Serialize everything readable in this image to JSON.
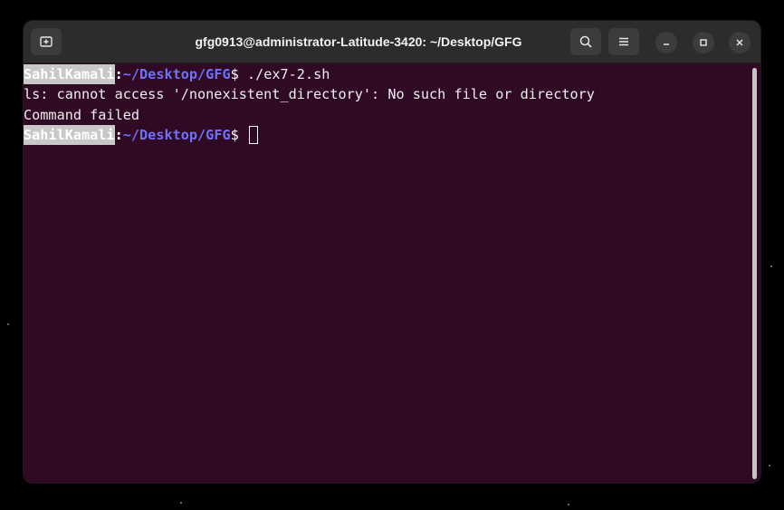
{
  "window": {
    "title": "gfg0913@administrator-Latitude-3420: ~/Desktop/GFG"
  },
  "terminal": {
    "lines": [
      {
        "type": "prompt",
        "user": "SahilKamali",
        "colon": ":",
        "path": "~/Desktop/GFG",
        "symbol": "$",
        "command": " ./ex7-2.sh"
      },
      {
        "type": "output",
        "text": "ls: cannot access '/nonexistent_directory': No such file or directory"
      },
      {
        "type": "output",
        "text": "Command failed"
      },
      {
        "type": "prompt",
        "user": "SahilKamali",
        "colon": ":",
        "path": "~/Desktop/GFG",
        "symbol": "$",
        "command": " "
      }
    ]
  },
  "icons": {
    "new_tab": "new-tab-icon",
    "search": "search-icon",
    "menu": "hamburger-menu-icon",
    "minimize": "minimize-icon",
    "maximize": "maximize-icon",
    "close": "close-icon"
  },
  "colors": {
    "terminal_bg": "#300a24",
    "titlebar_bg": "#2c2c2c",
    "path": "#6f72f5",
    "user_highlight": "#c8c8c8"
  }
}
